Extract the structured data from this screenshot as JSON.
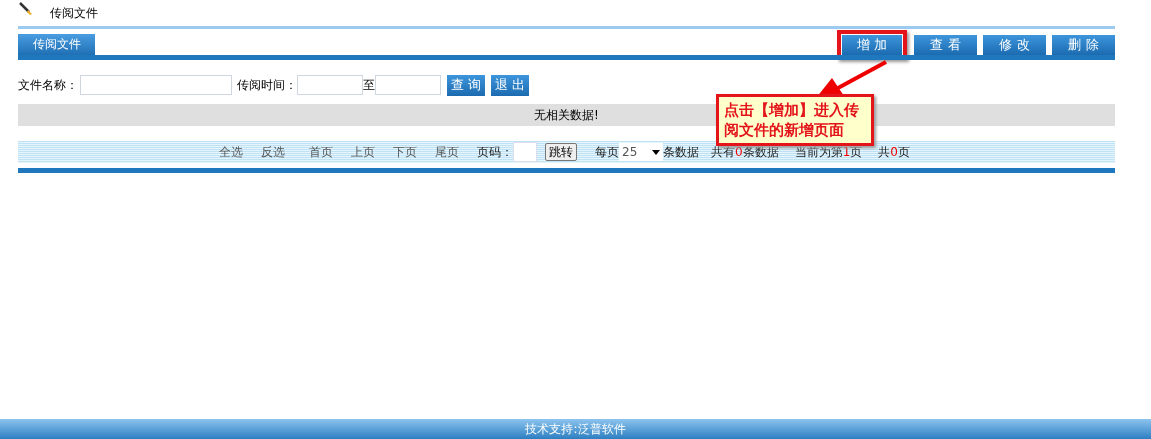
{
  "header": {
    "title": "传阅文件"
  },
  "tab": {
    "label": "传阅文件"
  },
  "actions": [
    {
      "label": "增 加",
      "highlighted": true
    },
    {
      "label": "查 看",
      "highlighted": false
    },
    {
      "label": "修 改",
      "highlighted": false
    },
    {
      "label": "删 除",
      "highlighted": false
    }
  ],
  "search": {
    "name_label": "文件名称：",
    "time_label": "传阅时间：",
    "range_separator": "至",
    "buttons": [
      "查 询",
      "退 出"
    ]
  },
  "empty_message": "无相关数据!",
  "pager": {
    "links": [
      "全选",
      "反选",
      "首页",
      "上页",
      "下页",
      "尾页"
    ],
    "page_label": "页码：",
    "jump_button": "跳转",
    "per_page_label": "每页",
    "per_page": "25",
    "per_page_suffix": "条数据",
    "stats": [
      {
        "before": "共有",
        "value": "0",
        "after": "条数据"
      },
      {
        "before": "当前为第",
        "value": "1",
        "after": "页"
      },
      {
        "before": "共",
        "value": "0",
        "after": "页"
      }
    ]
  },
  "callout": {
    "text": "点击【增加】进入传阅文件的新增页面"
  },
  "footer": {
    "text": "技术支持:泛普软件"
  }
}
